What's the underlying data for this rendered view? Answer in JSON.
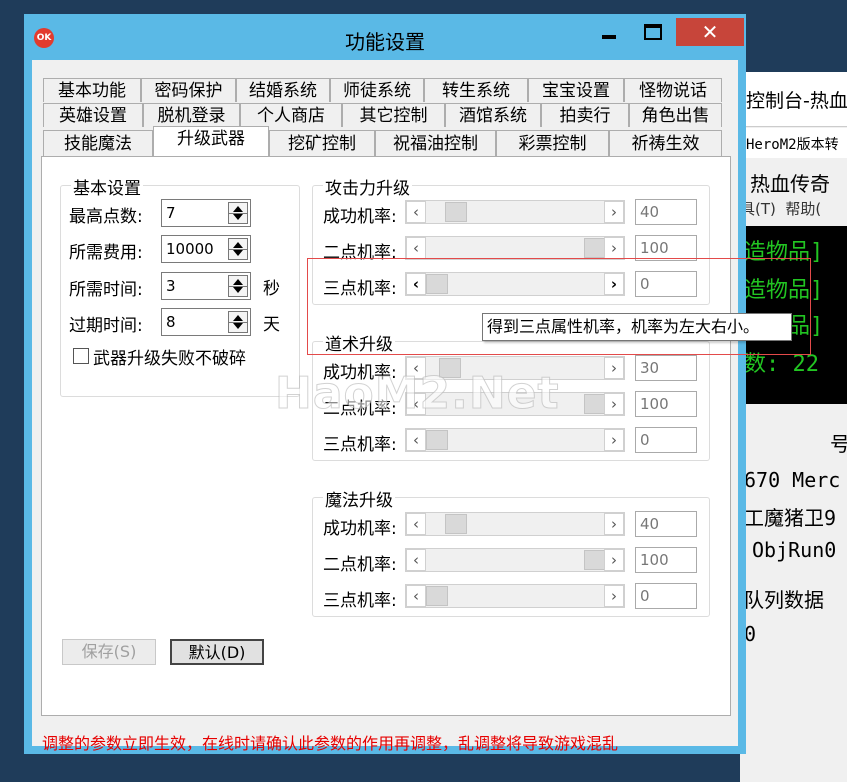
{
  "background_window": {
    "title": "控制台-热血",
    "subtitle": "HeroM2版本转",
    "heading": "热血传奇",
    "menu": [
      "具(T)",
      "帮助("
    ],
    "terminal_lines": [
      "造物品]",
      "造物品]",
      "造物品]",
      "数: 22"
    ],
    "lines": [
      "号",
      "670 Merc",
      "工魔猪卫9",
      "ObjRun0",
      "队列数据",
      "0"
    ]
  },
  "dialog": {
    "title": "功能设置",
    "close_glyph": "✕",
    "tabs_row1": [
      "基本功能",
      "密码保护",
      "结婚系统",
      "师徒系统",
      "转生系统",
      "宝宝设置",
      "怪物说话"
    ],
    "tabs_row2": [
      "英雄设置",
      "脱机登录",
      "个人商店",
      "其它控制",
      "酒馆系统",
      "拍卖行",
      "角色出售"
    ],
    "tabs_row3": [
      "技能魔法",
      "升级武器",
      "挖矿控制",
      "祝福油控制",
      "彩票控制",
      "祈祷生效"
    ],
    "active_tab": "升级武器",
    "basic": {
      "label": "基本设置",
      "fields": [
        {
          "label": "最高点数:",
          "value": "7",
          "unit": ""
        },
        {
          "label": "所需费用:",
          "value": "10000",
          "unit": ""
        },
        {
          "label": "所需时间:",
          "value": "3",
          "unit": "秒"
        },
        {
          "label": "过期时间:",
          "value": "8",
          "unit": "天"
        }
      ],
      "checkbox": "武器升级失败不破碎"
    },
    "groups": [
      {
        "label": "攻击力升级",
        "rows": [
          {
            "label": "成功机率:",
            "value": "40",
            "level": 0.12
          },
          {
            "label": "二点机率:",
            "value": "100",
            "level": 1.0
          },
          {
            "label": "三点机率:",
            "value": "0",
            "level": 0.0
          }
        ]
      },
      {
        "label": "道术升级",
        "rows": [
          {
            "label": "成功机率:",
            "value": "30",
            "level": 0.08
          },
          {
            "label": "二点机率:",
            "value": "100",
            "level": 1.0
          },
          {
            "label": "三点机率:",
            "value": "0",
            "level": 0.0
          }
        ]
      },
      {
        "label": "魔法升级",
        "rows": [
          {
            "label": "成功机率:",
            "value": "40",
            "level": 0.12
          },
          {
            "label": "二点机率:",
            "value": "100",
            "level": 1.0
          },
          {
            "label": "三点机率:",
            "value": "0",
            "level": 0.0
          }
        ]
      }
    ],
    "save_label": "保存(S)",
    "default_label": "默认(D)",
    "warning": "调整的参数立即生效，在线时请确认此参数的作用再调整，乱调整将导致游戏混乱",
    "tooltip": "得到三点属性机率，机率为左大右小。",
    "watermark": "HaoM2.Net"
  }
}
